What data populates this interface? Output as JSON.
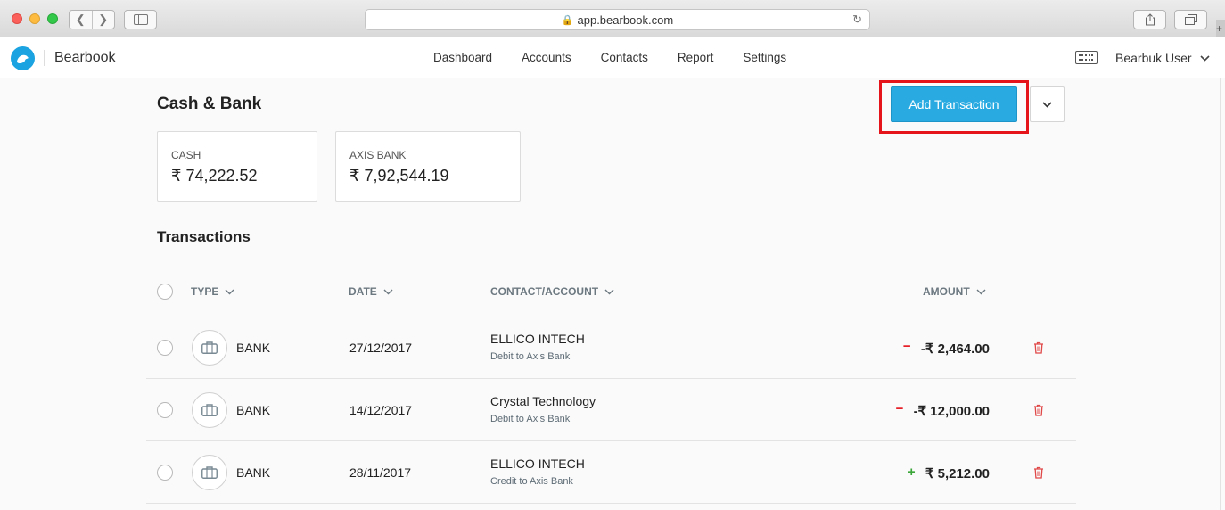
{
  "browser": {
    "url": "app.bearbook.com",
    "new_tab": "+"
  },
  "app": {
    "brand": "Bearbook",
    "nav": [
      "Dashboard",
      "Accounts",
      "Contacts",
      "Report",
      "Settings"
    ],
    "user": "Bearbuk User"
  },
  "page": {
    "title": "Cash & Bank",
    "add_button": "Add Transaction",
    "accounts": [
      {
        "label": "CASH",
        "value": "₹ 74,222.52"
      },
      {
        "label": "AXIS BANK",
        "value": "₹ 7,92,544.19"
      }
    ],
    "transactions_title": "Transactions"
  },
  "table": {
    "headers": {
      "type": "TYPE",
      "date": "DATE",
      "contact": "CONTACT/ACCOUNT",
      "amount": "AMOUNT"
    },
    "rows": [
      {
        "type": "BANK",
        "date": "27/12/2017",
        "contact": "ELLICO INTECH",
        "account": "Debit to Axis Bank",
        "sign": "−",
        "amount": "-₹ 2,464.00",
        "direction": "debit"
      },
      {
        "type": "BANK",
        "date": "14/12/2017",
        "contact": "Crystal Technology",
        "account": "Debit to Axis Bank",
        "sign": "−",
        "amount": "-₹ 12,000.00",
        "direction": "debit"
      },
      {
        "type": "BANK",
        "date": "28/11/2017",
        "contact": "ELLICO INTECH",
        "account": "Credit to Axis Bank",
        "sign": "+",
        "amount": "₹ 5,212.00",
        "direction": "credit"
      }
    ]
  },
  "colors": {
    "accent": "#29abe2",
    "highlight": "#e5141b",
    "debit": "#e5141b",
    "credit": "#3aa63a",
    "delete": "#e04848"
  }
}
